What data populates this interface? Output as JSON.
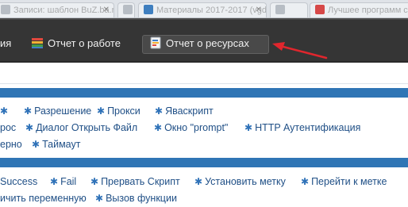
{
  "browser": {
    "tabs": [
      {
        "title": "Записи: шаблон BuZ.ba.ru"
      },
      {
        "title": ""
      },
      {
        "title": "Материалы 2017-2017 (vgd..."
      },
      {
        "title": ""
      },
      {
        "title": "Лучшее программ сапуи..."
      }
    ]
  },
  "toolbar": {
    "left_item": "ия",
    "work_report": "Отчет о работе",
    "resource_report": "Отчет о ресурсах"
  },
  "actions": {
    "row1": [
      "Разрешение",
      "Прокси",
      "Яваскрипт"
    ],
    "row2_fragment": "рос",
    "row2": [
      "Диалог Открыть Файл",
      "Окно \"prompt\"",
      "HTTP Аутентификация"
    ],
    "row3_fragment": "ерно",
    "row3": [
      "Таймаут"
    ]
  },
  "flow": {
    "row1_fragment": "Success",
    "row1": [
      "Fail",
      "Прервать Скрипт",
      "Установить метку",
      "Перейти к метке"
    ],
    "row2_fragment": "ичить переменную",
    "row2": [
      "Вызов функции"
    ]
  },
  "colors": {
    "accent_band": "#2f75b5",
    "toolbar_bg": "#353535",
    "link": "#1f4f86",
    "annotation_arrow": "#e0262d"
  }
}
